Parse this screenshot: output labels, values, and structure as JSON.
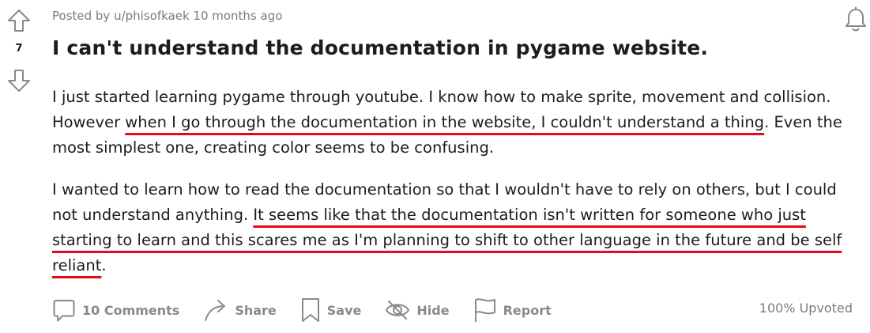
{
  "post": {
    "score": "7",
    "meta": "Posted by u/phisofkaek 10 months ago",
    "title": "I can't understand the documentation in pygame website.",
    "paragraph1": {
      "a": "I just started learning pygame through youtube. I know how to make sprite, movement and collision. However ",
      "highlight": "when I go through the documentation in the website, I couldn't understand a thing",
      "b": ". Even the most simplest one, creating color seems to be confusing."
    },
    "paragraph2": {
      "a": "I wanted to learn how to read the documentation so that I wouldn't have to rely on others, but I could not understand anything. ",
      "highlight": "It seems like that the documentation isn't written for someone who just starting to learn and this scares me as I'm planning to shift to other language in the future and be self reliant",
      "b": "."
    },
    "highlight_color": "#e8081c"
  },
  "actions": {
    "comments": "10 Comments",
    "share": "Share",
    "save": "Save",
    "hide": "Hide",
    "report": "Report"
  },
  "upvoted": "100% Upvoted",
  "icons": {
    "upvote": "arrow-up-outline-icon",
    "downvote": "arrow-down-outline-icon",
    "notify": "bell-icon",
    "comments": "speech-bubble-icon",
    "share": "share-arrow-icon",
    "save": "bookmark-icon",
    "hide": "eye-slash-icon",
    "report": "flag-icon"
  }
}
